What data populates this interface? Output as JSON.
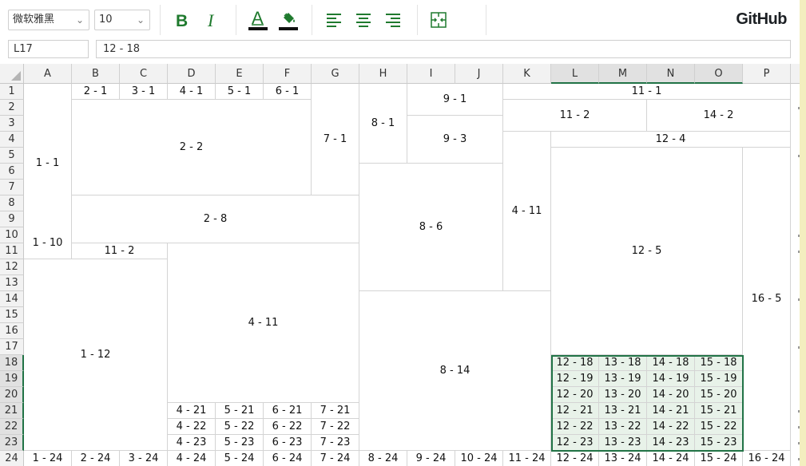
{
  "toolbar": {
    "font_name": "微软雅黑",
    "font_size": "10",
    "brand": "GitHub",
    "colors": {
      "accent": "#217346",
      "icon": "#1f7a2e",
      "selection_fill": "#e8f2e9"
    },
    "icons": [
      "bold-icon",
      "italic-icon",
      "font-color-icon",
      "fill-color-icon",
      "align-left-icon",
      "align-center-icon",
      "align-right-icon",
      "merge-cells-icon"
    ]
  },
  "formula_bar": {
    "cell_ref": "L17",
    "value": "12 - 18"
  },
  "columns": [
    "A",
    "B",
    "C",
    "D",
    "E",
    "F",
    "G",
    "H",
    "I",
    "J",
    "K",
    "L",
    "M",
    "N",
    "O",
    "P"
  ],
  "rows": [
    "1",
    "2",
    "3",
    "4",
    "5",
    "6",
    "7",
    "8",
    "9",
    "10",
    "11",
    "12",
    "13",
    "14",
    "15",
    "16",
    "17",
    "18",
    "19",
    "20",
    "21",
    "22",
    "23",
    "24"
  ],
  "cells": [
    {
      "r": 0,
      "c": 0,
      "rs": 10,
      "cs": 1,
      "v": "1 - 1"
    },
    {
      "r": 0,
      "c": 1,
      "rs": 1,
      "cs": 1,
      "v": "2 - 1"
    },
    {
      "r": 0,
      "c": 2,
      "rs": 1,
      "cs": 1,
      "v": "3 - 1"
    },
    {
      "r": 0,
      "c": 3,
      "rs": 1,
      "cs": 1,
      "v": "4 - 1"
    },
    {
      "r": 0,
      "c": 4,
      "rs": 1,
      "cs": 1,
      "v": "5 - 1"
    },
    {
      "r": 0,
      "c": 5,
      "rs": 1,
      "cs": 1,
      "v": "6 - 1"
    },
    {
      "r": 0,
      "c": 6,
      "rs": 7,
      "cs": 1,
      "v": "7 - 1"
    },
    {
      "r": 0,
      "c": 7,
      "rs": 5,
      "cs": 1,
      "v": "8 - 1"
    },
    {
      "r": 0,
      "c": 8,
      "rs": 2,
      "cs": 2,
      "v": "9 - 1"
    },
    {
      "r": 0,
      "c": 10,
      "rs": 1,
      "cs": 6,
      "v": "11 - 1"
    },
    {
      "r": 1,
      "c": 1,
      "rs": 6,
      "cs": 5,
      "v": "2 - 2"
    },
    {
      "r": 1,
      "c": 10,
      "rs": 2,
      "cs": 3,
      "v": "11 - 2"
    },
    {
      "r": 1,
      "c": 13,
      "rs": 2,
      "cs": 3,
      "v": "14 - 2"
    },
    {
      "r": 2,
      "c": 8,
      "rs": 3,
      "cs": 2,
      "v": "9 - 3"
    },
    {
      "r": 3,
      "c": 11,
      "rs": 1,
      "cs": 5,
      "v": "12 - 4"
    },
    {
      "r": 3,
      "c": 10,
      "rs": 10,
      "cs": 1,
      "v": "4 - 11"
    },
    {
      "r": 4,
      "c": 11,
      "rs": 13,
      "cs": 4,
      "v": "12 - 5"
    },
    {
      "r": 4,
      "c": 15,
      "rs": 19,
      "cs": 1,
      "v": "16 - 5"
    },
    {
      "r": 5,
      "c": 7,
      "rs": 8,
      "cs": 3,
      "v": "8 - 6"
    },
    {
      "r": 7,
      "c": 1,
      "rs": 3,
      "cs": 6,
      "v": "2 - 8"
    },
    {
      "r": 9,
      "c": 0,
      "rs": 2,
      "cs": 1,
      "v": "1 - 10"
    },
    {
      "r": 10,
      "c": 1,
      "rs": 1,
      "cs": 2,
      "v": "11 - 2"
    },
    {
      "r": 10,
      "c": 3,
      "rs": 10,
      "cs": 4,
      "v": "4 - 11"
    },
    {
      "r": 11,
      "c": 0,
      "rs": 12,
      "cs": 3,
      "v": "1 - 12"
    },
    {
      "r": 13,
      "c": 7,
      "rs": 10,
      "cs": 4,
      "v": "8 - 14"
    },
    {
      "r": 17,
      "c": 11,
      "rs": 1,
      "cs": 1,
      "v": "12 - 18",
      "hl": true
    },
    {
      "r": 17,
      "c": 12,
      "rs": 1,
      "cs": 1,
      "v": "13 - 18",
      "hl": true
    },
    {
      "r": 17,
      "c": 13,
      "rs": 1,
      "cs": 1,
      "v": "14 - 18",
      "hl": true
    },
    {
      "r": 17,
      "c": 14,
      "rs": 1,
      "cs": 1,
      "v": "15 - 18",
      "hl": true
    },
    {
      "r": 18,
      "c": 11,
      "rs": 1,
      "cs": 1,
      "v": "12 - 19",
      "hl": true
    },
    {
      "r": 18,
      "c": 12,
      "rs": 1,
      "cs": 1,
      "v": "13 - 19",
      "hl": true
    },
    {
      "r": 18,
      "c": 13,
      "rs": 1,
      "cs": 1,
      "v": "14 - 19",
      "hl": true
    },
    {
      "r": 18,
      "c": 14,
      "rs": 1,
      "cs": 1,
      "v": "15 - 19",
      "hl": true
    },
    {
      "r": 19,
      "c": 11,
      "rs": 1,
      "cs": 1,
      "v": "12 - 20",
      "hl": true
    },
    {
      "r": 19,
      "c": 12,
      "rs": 1,
      "cs": 1,
      "v": "13 - 20",
      "hl": true
    },
    {
      "r": 19,
      "c": 13,
      "rs": 1,
      "cs": 1,
      "v": "14 - 20",
      "hl": true
    },
    {
      "r": 19,
      "c": 14,
      "rs": 1,
      "cs": 1,
      "v": "15 - 20",
      "hl": true
    },
    {
      "r": 20,
      "c": 3,
      "rs": 1,
      "cs": 1,
      "v": "4 - 21"
    },
    {
      "r": 20,
      "c": 4,
      "rs": 1,
      "cs": 1,
      "v": "5 - 21"
    },
    {
      "r": 20,
      "c": 5,
      "rs": 1,
      "cs": 1,
      "v": "6 - 21"
    },
    {
      "r": 20,
      "c": 6,
      "rs": 1,
      "cs": 1,
      "v": "7 - 21"
    },
    {
      "r": 20,
      "c": 11,
      "rs": 1,
      "cs": 1,
      "v": "12 - 21",
      "hl": true
    },
    {
      "r": 20,
      "c": 12,
      "rs": 1,
      "cs": 1,
      "v": "13 - 21",
      "hl": true
    },
    {
      "r": 20,
      "c": 13,
      "rs": 1,
      "cs": 1,
      "v": "14 - 21",
      "hl": true
    },
    {
      "r": 20,
      "c": 14,
      "rs": 1,
      "cs": 1,
      "v": "15 - 21",
      "hl": true
    },
    {
      "r": 21,
      "c": 3,
      "rs": 1,
      "cs": 1,
      "v": "4 - 22"
    },
    {
      "r": 21,
      "c": 4,
      "rs": 1,
      "cs": 1,
      "v": "5 - 22"
    },
    {
      "r": 21,
      "c": 5,
      "rs": 1,
      "cs": 1,
      "v": "6 - 22"
    },
    {
      "r": 21,
      "c": 6,
      "rs": 1,
      "cs": 1,
      "v": "7 - 22"
    },
    {
      "r": 21,
      "c": 11,
      "rs": 1,
      "cs": 1,
      "v": "12 - 22",
      "hl": true
    },
    {
      "r": 21,
      "c": 12,
      "rs": 1,
      "cs": 1,
      "v": "13 - 22",
      "hl": true
    },
    {
      "r": 21,
      "c": 13,
      "rs": 1,
      "cs": 1,
      "v": "14 - 22",
      "hl": true
    },
    {
      "r": 21,
      "c": 14,
      "rs": 1,
      "cs": 1,
      "v": "15 - 22",
      "hl": true
    },
    {
      "r": 22,
      "c": 3,
      "rs": 1,
      "cs": 1,
      "v": "4 - 23"
    },
    {
      "r": 22,
      "c": 4,
      "rs": 1,
      "cs": 1,
      "v": "5 - 23"
    },
    {
      "r": 22,
      "c": 5,
      "rs": 1,
      "cs": 1,
      "v": "6 - 23"
    },
    {
      "r": 22,
      "c": 6,
      "rs": 1,
      "cs": 1,
      "v": "7 - 23"
    },
    {
      "r": 22,
      "c": 11,
      "rs": 1,
      "cs": 1,
      "v": "12 - 23",
      "hl": true
    },
    {
      "r": 22,
      "c": 12,
      "rs": 1,
      "cs": 1,
      "v": "13 - 23",
      "hl": true
    },
    {
      "r": 22,
      "c": 13,
      "rs": 1,
      "cs": 1,
      "v": "14 - 23",
      "hl": true
    },
    {
      "r": 22,
      "c": 14,
      "rs": 1,
      "cs": 1,
      "v": "15 - 23",
      "hl": true
    },
    {
      "r": 23,
      "c": 0,
      "rs": 1,
      "cs": 1,
      "v": "1 - 24"
    },
    {
      "r": 23,
      "c": 1,
      "rs": 1,
      "cs": 1,
      "v": "2 - 24"
    },
    {
      "r": 23,
      "c": 2,
      "rs": 1,
      "cs": 1,
      "v": "3 - 24"
    },
    {
      "r": 23,
      "c": 3,
      "rs": 1,
      "cs": 1,
      "v": "4 - 24"
    },
    {
      "r": 23,
      "c": 4,
      "rs": 1,
      "cs": 1,
      "v": "5 - 24"
    },
    {
      "r": 23,
      "c": 5,
      "rs": 1,
      "cs": 1,
      "v": "6 - 24"
    },
    {
      "r": 23,
      "c": 6,
      "rs": 1,
      "cs": 1,
      "v": "7 - 24"
    },
    {
      "r": 23,
      "c": 7,
      "rs": 1,
      "cs": 1,
      "v": "8 - 24"
    },
    {
      "r": 23,
      "c": 8,
      "rs": 1,
      "cs": 1,
      "v": "9 - 24"
    },
    {
      "r": 23,
      "c": 9,
      "rs": 1,
      "cs": 1,
      "v": "10 - 24"
    },
    {
      "r": 23,
      "c": 10,
      "rs": 1,
      "cs": 1,
      "v": "11 - 24"
    },
    {
      "r": 23,
      "c": 11,
      "rs": 1,
      "cs": 1,
      "v": "12 - 24"
    },
    {
      "r": 23,
      "c": 12,
      "rs": 1,
      "cs": 1,
      "v": "13 - 24"
    },
    {
      "r": 23,
      "c": 13,
      "rs": 1,
      "cs": 1,
      "v": "14 - 24"
    },
    {
      "r": 23,
      "c": 14,
      "rs": 1,
      "cs": 1,
      "v": "15 - 24"
    },
    {
      "r": 23,
      "c": 15,
      "rs": 1,
      "cs": 1,
      "v": "16 - 24"
    }
  ],
  "active_columns": [
    "L",
    "M",
    "N",
    "O"
  ],
  "active_rows": [
    "18",
    "19",
    "20",
    "21",
    "22",
    "23"
  ]
}
